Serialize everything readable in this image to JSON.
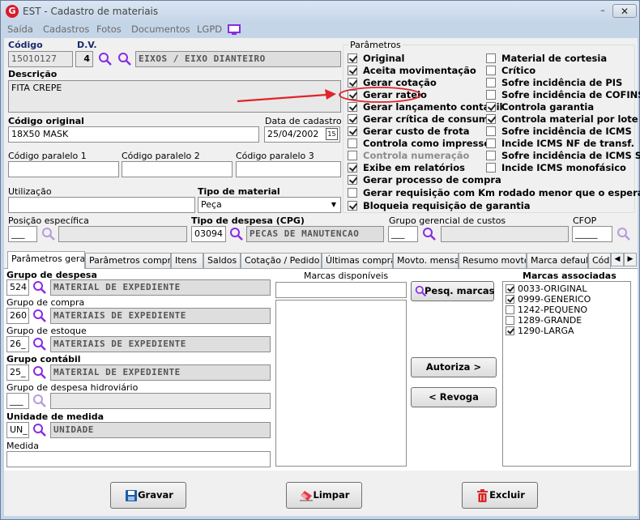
{
  "window": {
    "title": "EST - Cadastro de materiais",
    "logo": "G",
    "min": "–",
    "close": "✕"
  },
  "menu": [
    "Saída",
    "Cadastros",
    "Fotos",
    "Documentos",
    "LGPD"
  ],
  "form": {
    "codigo_label": "Código",
    "codigo": "15010127",
    "dv_label": "D.V.",
    "dv": "4",
    "grupo_desc": "EIXOS / EIXO DIANTEIRO",
    "descricao_label": "Descrição",
    "descricao": "FITA CREPE",
    "codigo_original_label": "Código original",
    "codigo_original": "18X50 MASK",
    "data_cadastro_label": "Data de cadastro",
    "data_cadastro": "25/04/2002",
    "cal_icon": "15",
    "cp1_label": "Código paralelo 1",
    "cp2_label": "Código paralelo 2",
    "cp3_label": "Código paralelo 3",
    "utilizacao_label": "Utilização",
    "tipo_material_label": "Tipo de material",
    "tipo_material": "Peça",
    "posicao_label": "Posição específica",
    "posicao": "___",
    "tipo_despesa_label": "Tipo de despesa (CPG)",
    "tipo_despesa": "03094",
    "tipo_despesa_desc": "PECAS DE MANUTENCAO",
    "grupo_ger_label": "Grupo gerencial de custos",
    "grupo_ger": "___",
    "cfop_label": "CFOP",
    "cfop": "_____"
  },
  "params": {
    "label": "Parâmetros",
    "left": [
      {
        "label": "Original",
        "checked": true
      },
      {
        "label": "Aceita movimentação",
        "checked": true
      },
      {
        "label": "Gerar cotação",
        "checked": true
      },
      {
        "label": "Gerar rateio",
        "checked": true
      },
      {
        "label": "Gerar lançamento contábil",
        "checked": true
      },
      {
        "label": "Gerar crítica de consumo",
        "checked": true
      },
      {
        "label": "Gerar custo de frota",
        "checked": true
      },
      {
        "label": "Controla como impresso",
        "checked": false
      },
      {
        "label": "Controla numeração",
        "checked": false
      },
      {
        "label": "Exibe em relatórios",
        "checked": true
      }
    ],
    "right": [
      {
        "label": "Material de cortesia",
        "checked": false
      },
      {
        "label": "Crítico",
        "checked": false
      },
      {
        "label": "Sofre incidência de PIS",
        "checked": false
      },
      {
        "label": "Sofre incidência de COFINS",
        "checked": false
      },
      {
        "label": "Controla garantia",
        "checked": true
      },
      {
        "label": "Controla material por lote",
        "checked": true
      },
      {
        "label": "Sofre incidência de ICMS",
        "checked": false
      },
      {
        "label": "Incide ICMS NF de transf.",
        "checked": false
      },
      {
        "label": "Sofre incidência de ICMS ST",
        "checked": false
      },
      {
        "label": "Incide ICMS monofásico",
        "checked": false
      }
    ],
    "full": [
      {
        "label": "Gerar processo de compra",
        "checked": true
      },
      {
        "label": "Gerar requisição com Km rodado menor que o esperado",
        "checked": false
      },
      {
        "label": "Bloqueia requisição de garantia",
        "checked": true
      }
    ]
  },
  "tabs": [
    "Parâmetros gerais",
    "Parâmetros compras",
    "Itens",
    "Saldos",
    "Cotação / Pedido",
    "Últimas compras",
    "Movto. mensal",
    "Resumo movto.",
    "Marca default",
    "Códi"
  ],
  "tab_arrows": [
    "◀",
    "▶"
  ],
  "general": {
    "grupo_despesa_label": "Grupo de despesa",
    "grupo_despesa": "524",
    "grupo_despesa_desc": "MATERIAL DE EXPEDIENTE",
    "grupo_compra_label": "Grupo de compra",
    "grupo_compra": "260",
    "grupo_compra_desc": "MATERIAIS DE EXPEDIENTE",
    "grupo_estoque_label": "Grupo de estoque",
    "grupo_estoque": "26_",
    "grupo_estoque_desc": "MATERIAIS DE EXPEDIENTE",
    "grupo_contabil_label": "Grupo contábil",
    "grupo_contabil": "25_",
    "grupo_contabil_desc": "MATERIAL DE EXPEDIENTE",
    "grupo_hidro_label": "Grupo de despesa hidroviário",
    "grupo_hidro": "___",
    "unidade_label": "Unidade de medida",
    "unidade": "UN_",
    "unidade_desc": "UNIDADE",
    "medida_label": "Medida"
  },
  "marcas": {
    "disponiveis_label": "Marcas disponíveis",
    "associadas_label": "Marcas associadas",
    "pesq_label": "Pesq. marcas",
    "autoriza_label": "Autoriza >",
    "revoga_label": "< Revoga",
    "associadas": [
      {
        "label": "0033-ORIGINAL",
        "checked": true
      },
      {
        "label": "0999-GENERICO",
        "checked": true
      },
      {
        "label": "1242-PEQUENO",
        "checked": false
      },
      {
        "label": "1289-GRANDE",
        "checked": false
      },
      {
        "label": "1290-LARGA",
        "checked": true
      }
    ]
  },
  "buttons": {
    "gravar": "Gravar",
    "limpar": "Limpar",
    "excluir": "Excluir"
  },
  "colors": {
    "annotation_red": "#e0242b",
    "icon_purple": "#8a2be2"
  }
}
